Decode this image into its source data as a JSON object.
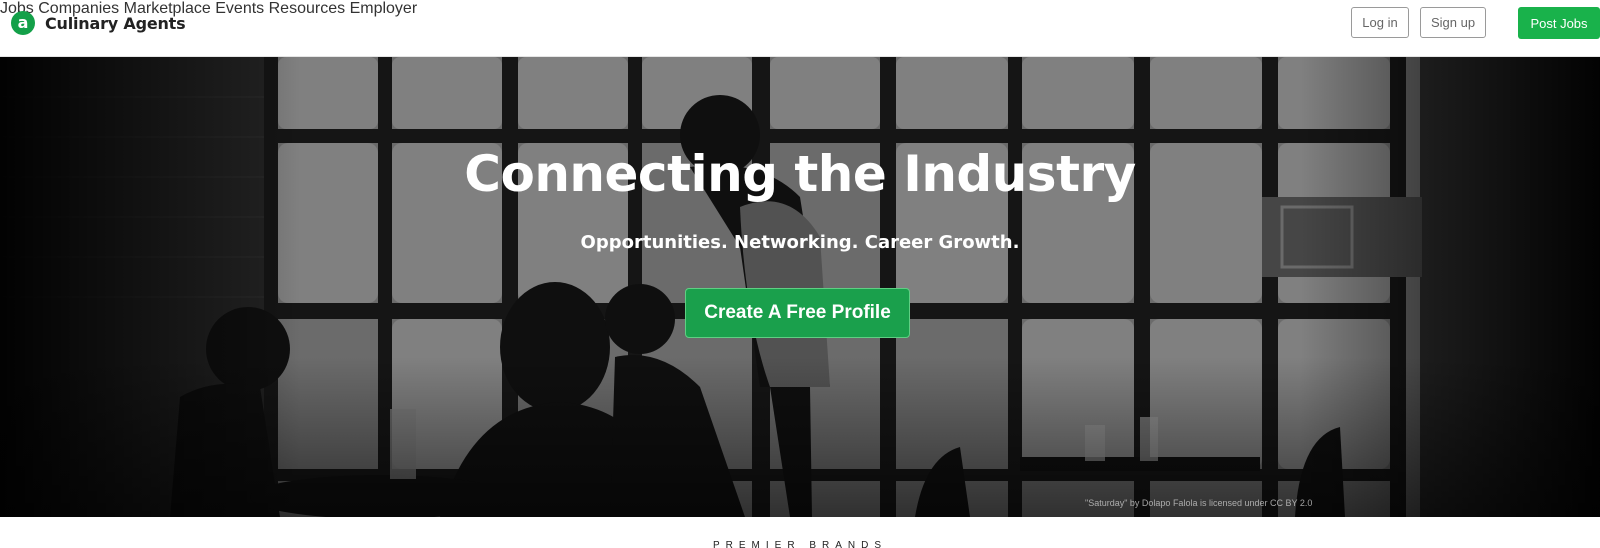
{
  "brand": {
    "logo_letter": "a",
    "name": "Culinary Agents",
    "accent": "#13a049"
  },
  "nav": {
    "items": [
      {
        "label": "Jobs"
      },
      {
        "label": "Companies"
      },
      {
        "label": "Marketplace"
      },
      {
        "label": "Events"
      },
      {
        "label": "Resources"
      },
      {
        "label": "Employer"
      }
    ],
    "login_label": "Log in",
    "signup_label": "Sign up",
    "post_jobs_label": "Post Jobs",
    "post_jobs_color": "#19b24b"
  },
  "hero": {
    "title": "Connecting the Industry",
    "subtitle": "Opportunities. Networking. Career Growth.",
    "cta_label": "Create A Free Profile",
    "photo_credit": "\"Saturday\" by Dolapo Falola is licensed under CC BY 2.0"
  },
  "section": {
    "label": "PREMIER BRANDS"
  }
}
